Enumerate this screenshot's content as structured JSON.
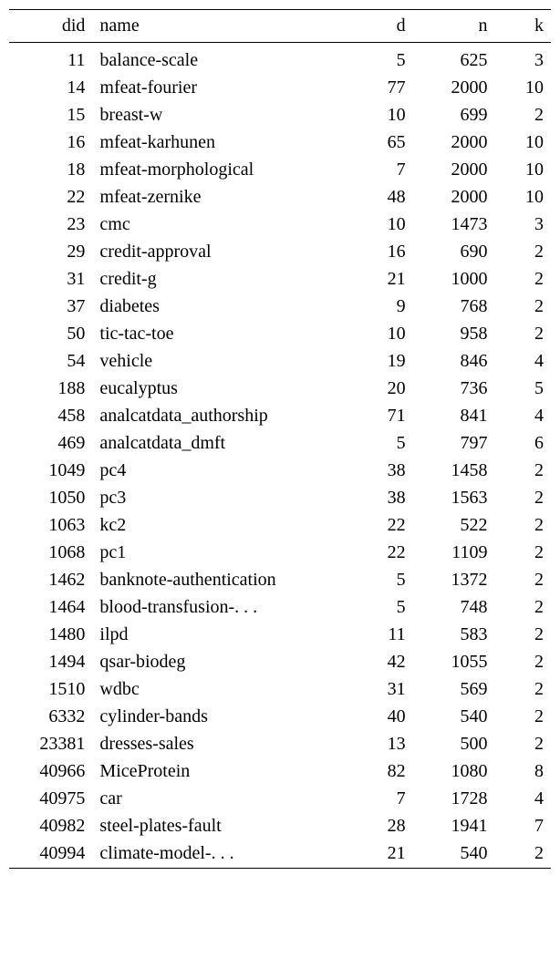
{
  "chart_data": {
    "type": "table",
    "columns": [
      "did",
      "name",
      "d",
      "n",
      "k"
    ],
    "rows": [
      {
        "did": 11,
        "name": "balance-scale",
        "d": 5,
        "n": 625,
        "k": 3
      },
      {
        "did": 14,
        "name": "mfeat-fourier",
        "d": 77,
        "n": 2000,
        "k": 10
      },
      {
        "did": 15,
        "name": "breast-w",
        "d": 10,
        "n": 699,
        "k": 2
      },
      {
        "did": 16,
        "name": "mfeat-karhunen",
        "d": 65,
        "n": 2000,
        "k": 10
      },
      {
        "did": 18,
        "name": "mfeat-morphological",
        "d": 7,
        "n": 2000,
        "k": 10
      },
      {
        "did": 22,
        "name": "mfeat-zernike",
        "d": 48,
        "n": 2000,
        "k": 10
      },
      {
        "did": 23,
        "name": "cmc",
        "d": 10,
        "n": 1473,
        "k": 3
      },
      {
        "did": 29,
        "name": "credit-approval",
        "d": 16,
        "n": 690,
        "k": 2
      },
      {
        "did": 31,
        "name": "credit-g",
        "d": 21,
        "n": 1000,
        "k": 2
      },
      {
        "did": 37,
        "name": "diabetes",
        "d": 9,
        "n": 768,
        "k": 2
      },
      {
        "did": 50,
        "name": "tic-tac-toe",
        "d": 10,
        "n": 958,
        "k": 2
      },
      {
        "did": 54,
        "name": "vehicle",
        "d": 19,
        "n": 846,
        "k": 4
      },
      {
        "did": 188,
        "name": "eucalyptus",
        "d": 20,
        "n": 736,
        "k": 5
      },
      {
        "did": 458,
        "name": "analcatdata_authorship",
        "d": 71,
        "n": 841,
        "k": 4
      },
      {
        "did": 469,
        "name": "analcatdata_dmft",
        "d": 5,
        "n": 797,
        "k": 6
      },
      {
        "did": 1049,
        "name": "pc4",
        "d": 38,
        "n": 1458,
        "k": 2
      },
      {
        "did": 1050,
        "name": "pc3",
        "d": 38,
        "n": 1563,
        "k": 2
      },
      {
        "did": 1063,
        "name": "kc2",
        "d": 22,
        "n": 522,
        "k": 2
      },
      {
        "did": 1068,
        "name": "pc1",
        "d": 22,
        "n": 1109,
        "k": 2
      },
      {
        "did": 1462,
        "name": "banknote-authentication",
        "d": 5,
        "n": 1372,
        "k": 2
      },
      {
        "did": 1464,
        "name": "blood-transfusion-. . .",
        "d": 5,
        "n": 748,
        "k": 2
      },
      {
        "did": 1480,
        "name": "ilpd",
        "d": 11,
        "n": 583,
        "k": 2
      },
      {
        "did": 1494,
        "name": "qsar-biodeg",
        "d": 42,
        "n": 1055,
        "k": 2
      },
      {
        "did": 1510,
        "name": "wdbc",
        "d": 31,
        "n": 569,
        "k": 2
      },
      {
        "did": 6332,
        "name": "cylinder-bands",
        "d": 40,
        "n": 540,
        "k": 2
      },
      {
        "did": 23381,
        "name": "dresses-sales",
        "d": 13,
        "n": 500,
        "k": 2
      },
      {
        "did": 40966,
        "name": "MiceProtein",
        "d": 82,
        "n": 1080,
        "k": 8
      },
      {
        "did": 40975,
        "name": "car",
        "d": 7,
        "n": 1728,
        "k": 4
      },
      {
        "did": 40982,
        "name": "steel-plates-fault",
        "d": 28,
        "n": 1941,
        "k": 7
      },
      {
        "did": 40994,
        "name": "climate-model-. . .",
        "d": 21,
        "n": 540,
        "k": 2
      }
    ]
  },
  "headers": {
    "did": "did",
    "name": "name",
    "d": "d",
    "n": "n",
    "k": "k"
  }
}
